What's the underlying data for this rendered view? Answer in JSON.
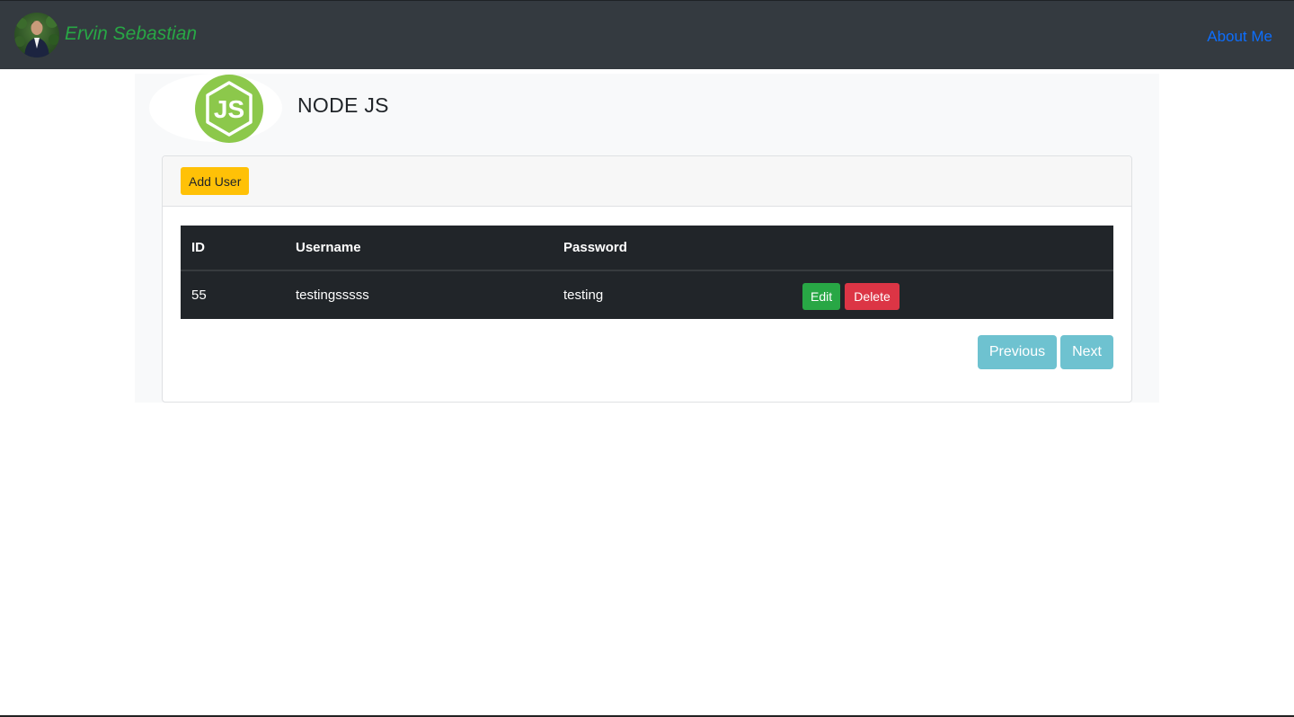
{
  "navbar": {
    "brand_name": "Ervin Sebastian",
    "avatar_icon": "profile-photo",
    "links": [
      {
        "label": "About Me"
      }
    ],
    "colors": {
      "background": "#343a40",
      "brand": "#28a745",
      "link": "#0d6efd"
    }
  },
  "header": {
    "logo_icon": "nodejs-logo",
    "logo_text": "JS",
    "title": "NODE JS"
  },
  "card": {
    "add_button_label": "Add User",
    "table": {
      "columns": [
        "ID",
        "Username",
        "Password",
        ""
      ],
      "rows": [
        {
          "id": "55",
          "username": "testingsssss",
          "password": "testing",
          "edit_label": "Edit",
          "delete_label": "Delete"
        }
      ]
    },
    "pagination": {
      "previous_label": "Previous",
      "next_label": "Next"
    }
  },
  "colors": {
    "add_button": "#ffc107",
    "edit_button": "#28a745",
    "delete_button": "#dc3545",
    "pagination_button": "#6ec2d0",
    "table_background": "#212529"
  }
}
